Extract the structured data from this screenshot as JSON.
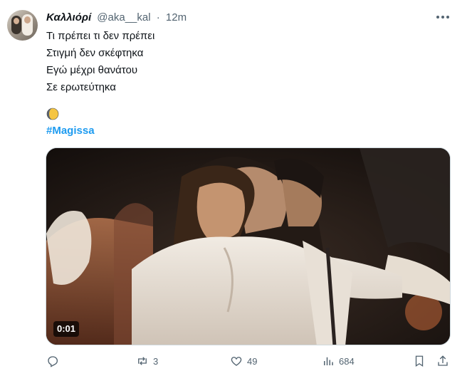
{
  "tweet": {
    "author_name": "Καλλιόρί",
    "handle": "@aka__kal",
    "separator": "·",
    "time": "12m",
    "lines": [
      "Τι πρέπει τι δεν πρέπει",
      "Στιγμή δεν σκέφτηκα",
      "Εγώ μέχρι θανάτου",
      "Σε ερωτεύτηκα"
    ],
    "emoji": "moon-icon",
    "hashtag": "#Magissa"
  },
  "media": {
    "duration": "0:01"
  },
  "actions": {
    "reply_count": "",
    "retweet_count": "3",
    "like_count": "49",
    "views_count": "684"
  },
  "colors": {
    "accent": "#1d9bf0",
    "secondary_text": "#536471",
    "primary_text": "#0f1419"
  }
}
